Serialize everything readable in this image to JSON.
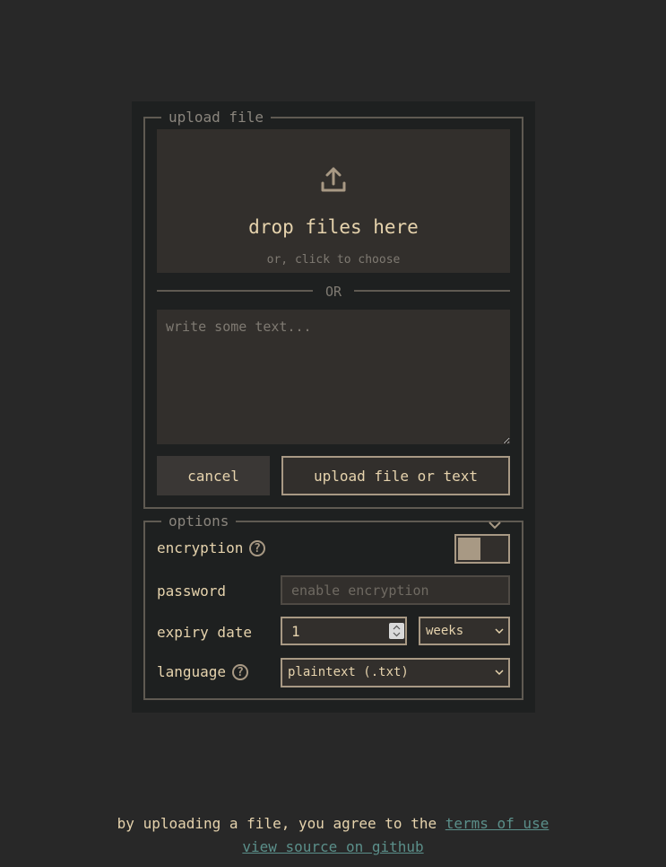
{
  "upload": {
    "legend": "upload file",
    "drop_title": "drop files here",
    "drop_sub": "or, click to choose",
    "or_text": "OR",
    "text_placeholder": "write some text...",
    "cancel_label": "cancel",
    "upload_label": "upload file or text"
  },
  "options": {
    "legend": "options",
    "encryption_label": "encryption",
    "encryption_enabled": false,
    "password_label": "password",
    "password_placeholder": "enable encryption",
    "expiry_label": "expiry date",
    "expiry_value": "1",
    "expiry_unit": "weeks",
    "language_label": "language",
    "language_value": "plaintext (.txt)",
    "help_glyph": "?"
  },
  "footer": {
    "agree_text": "by uploading a file, you agree to the",
    "terms_link": "terms of use",
    "github_link": "view source on github"
  },
  "icons": {
    "upload": "upload-icon",
    "help": "help-icon",
    "chevron": "chevron-down-icon"
  },
  "colors": {
    "background": "#282828",
    "panel": "#1e2020",
    "accent": "#a89984",
    "text": "#e6d3ad",
    "link": "#5b8f8a"
  }
}
